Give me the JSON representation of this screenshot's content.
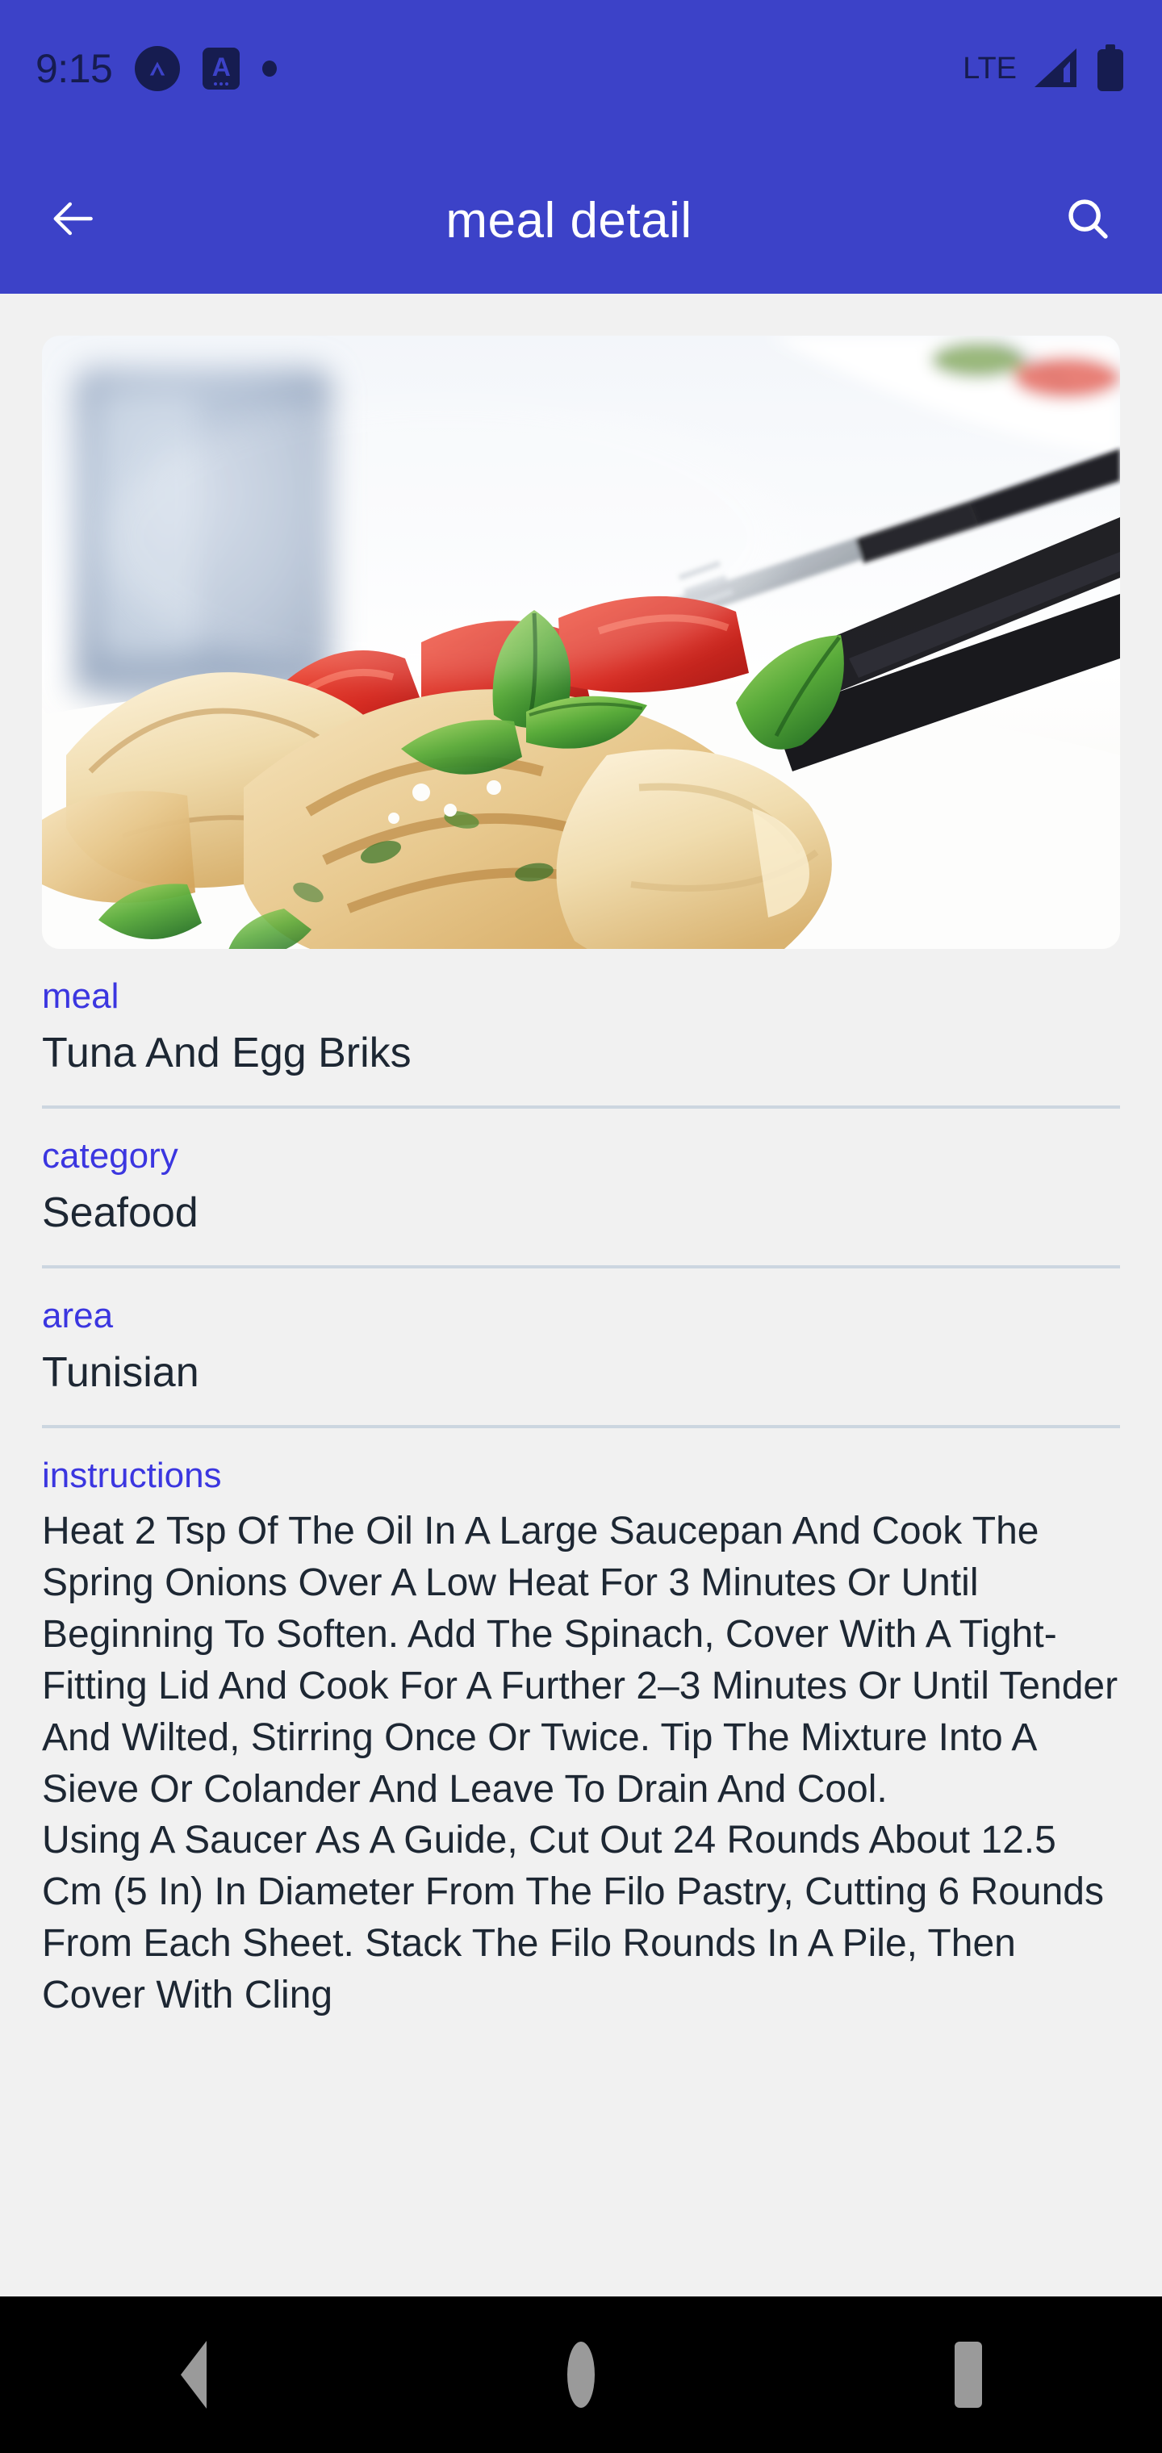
{
  "theme": {
    "app_bar_color": "#3c42c8",
    "status_icon_color": "#161c50",
    "label_accent": "#3b36e0",
    "body_text": "#1d2733",
    "page_background": "#f1f1f1",
    "divider": "#ccd6e0",
    "nav_bar_background": "#000000",
    "nav_icon_color": "#9a9a9a"
  },
  "status_bar": {
    "time": "9:15",
    "notification_icons": [
      "circle-caret-icon",
      "app-a-icon",
      "dot-icon"
    ],
    "network_label": "LTE",
    "signal_icon": "signal-bars-icon",
    "battery_icon": "battery-full-icon"
  },
  "app_bar": {
    "back_icon": "arrow-left-icon",
    "title": "meal detail",
    "search_icon": "search-icon"
  },
  "hero": {
    "alt": "Tuna and egg briks plated with tomato, mint leaves and a fork"
  },
  "fields": [
    {
      "label": "meal",
      "value": "Tuna And Egg Briks"
    },
    {
      "label": "category",
      "value": "Seafood"
    },
    {
      "label": "area",
      "value": "Tunisian"
    }
  ],
  "instructions": {
    "label": "instructions",
    "text": "Heat 2 Tsp Of The Oil In A Large Saucepan And Cook The Spring Onions Over A Low Heat For 3 Minutes Or Until Beginning To Soften. Add The Spinach, Cover With A Tight-Fitting Lid And Cook For A Further 2–3 Minutes Or Until Tender And Wilted, Stirring Once Or Twice. Tip The Mixture Into A Sieve Or Colander And Leave To Drain And Cool.\nUsing A Saucer As A Guide, Cut Out 24 Rounds About 12.5 Cm (5 In) In Diameter From The Filo Pastry, Cutting 6 Rounds From Each Sheet. Stack The Filo Rounds In A Pile, Then Cover With Cling"
  },
  "nav_bar": {
    "back_label": "Back",
    "home_label": "Home",
    "recents_label": "Recents"
  }
}
